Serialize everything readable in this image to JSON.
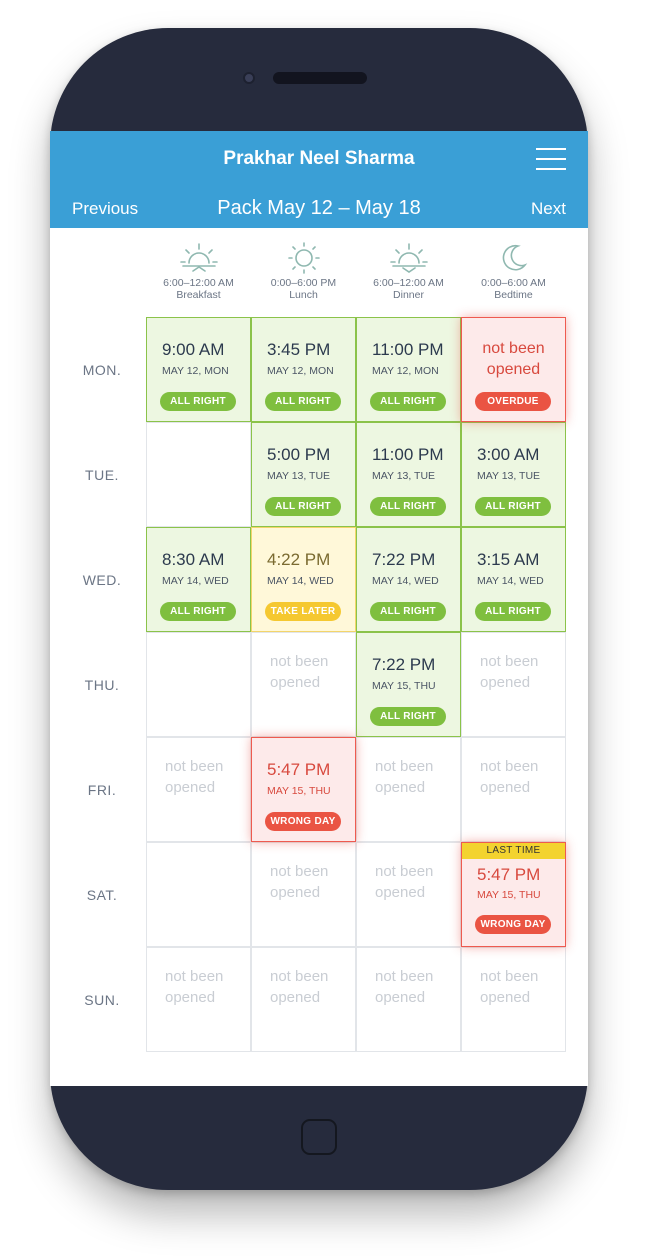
{
  "header": {
    "user_name": "Prakhar Neel Sharma",
    "prev_label": "Previous",
    "next_label": "Next",
    "pack_title": "Pack May 12 – May 18",
    "menu_icon": "hamburger-menu-icon",
    "bg_color": "#3a9fd6"
  },
  "periods": [
    {
      "range": "6:00–12:00 AM",
      "label": "Breakfast",
      "icon": "sunrise-icon"
    },
    {
      "range": "0:00–6:00 PM",
      "label": "Lunch",
      "icon": "sun-icon"
    },
    {
      "range": "6:00–12:00 AM",
      "label": "Dinner",
      "icon": "sunset-icon"
    },
    {
      "range": "0:00–6:00 AM",
      "label": "Bedtime",
      "icon": "moon-icon"
    }
  ],
  "days": [
    "MON.",
    "TUE.",
    "WED.",
    "THU.",
    "FRI.",
    "SAT.",
    "SUN."
  ],
  "statuses": {
    "ok": "ALL RIGHT",
    "later": "TAKE LATER",
    "wrong": "WRONG DAY",
    "overdue": "OVERDUE",
    "not_opened": "not been opened",
    "last_time": "LAST TIME"
  },
  "cells": [
    [
      {
        "state": "ok",
        "time": "9:00 AM",
        "date": "MAY 12, MON",
        "badge": "ALL RIGHT"
      },
      {
        "state": "ok",
        "time": "3:45 PM",
        "date": "MAY 12, MON",
        "badge": "ALL RIGHT"
      },
      {
        "state": "ok",
        "time": "11:00 PM",
        "date": "MAY 12, MON",
        "badge": "ALL RIGHT"
      },
      {
        "state": "overdue",
        "text": "not been opened",
        "badge": "OVERDUE"
      }
    ],
    [
      {
        "state": "empty"
      },
      {
        "state": "ok",
        "time": "5:00 PM",
        "date": "MAY 13, TUE",
        "badge": "ALL RIGHT"
      },
      {
        "state": "ok",
        "time": "11:00 PM",
        "date": "MAY 13, TUE",
        "badge": "ALL RIGHT"
      },
      {
        "state": "ok",
        "time": "3:00 AM",
        "date": "MAY 13, TUE",
        "badge": "ALL RIGHT"
      }
    ],
    [
      {
        "state": "ok",
        "time": "8:30 AM",
        "date": "MAY 14, WED",
        "badge": "ALL RIGHT"
      },
      {
        "state": "later",
        "time": "4:22 PM",
        "date": "MAY 14, WED",
        "badge": "TAKE LATER"
      },
      {
        "state": "ok",
        "time": "7:22 PM",
        "date": "MAY 14, WED",
        "badge": "ALL RIGHT"
      },
      {
        "state": "ok",
        "time": "3:15 AM",
        "date": "MAY 14, WED",
        "badge": "ALL RIGHT"
      }
    ],
    [
      {
        "state": "empty"
      },
      {
        "state": "not",
        "text": "not been opened"
      },
      {
        "state": "ok",
        "time": "7:22 PM",
        "date": "MAY 15, THU",
        "badge": "ALL RIGHT"
      },
      {
        "state": "not",
        "text": "not been opened"
      }
    ],
    [
      {
        "state": "not",
        "text": "not been opened"
      },
      {
        "state": "wrong",
        "time": "5:47 PM",
        "date": "MAY 15, THU",
        "badge": "WRONG DAY"
      },
      {
        "state": "not",
        "text": "not been opened"
      },
      {
        "state": "not",
        "text": "not been opened"
      }
    ],
    [
      {
        "state": "empty"
      },
      {
        "state": "not",
        "text": "not been opened"
      },
      {
        "state": "not",
        "text": "not been opened"
      },
      {
        "state": "wrong",
        "time": "5:47 PM",
        "date": "MAY 15, THU",
        "badge": "WRONG DAY",
        "tag": "LAST TIME"
      }
    ],
    [
      {
        "state": "not",
        "text": "not been opened"
      },
      {
        "state": "not",
        "text": "not been opened"
      },
      {
        "state": "not",
        "text": "not been opened"
      },
      {
        "state": "not",
        "text": "not been opened"
      }
    ]
  ]
}
